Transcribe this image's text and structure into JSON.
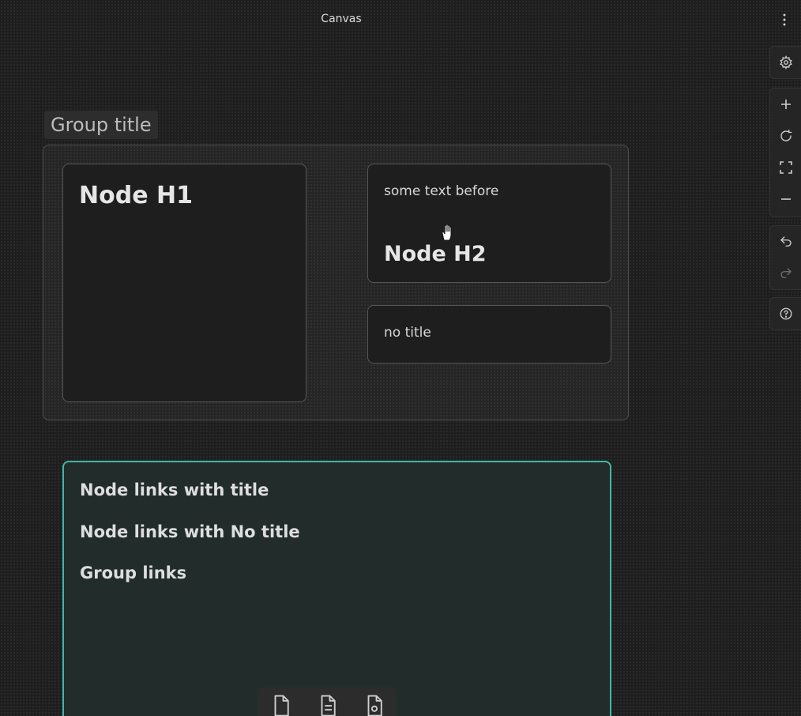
{
  "window": {
    "title": "Canvas"
  },
  "group": {
    "title": "Group title"
  },
  "nodes": {
    "h1_title": "Node H1",
    "h2_text_before": "some text before",
    "h2_title": "Node H2",
    "no_title_text": "no title"
  },
  "links_node": {
    "links": [
      "Node links with title",
      "Node links with No title",
      "Group links"
    ]
  },
  "toolbar": {
    "right_icons": [
      "settings-icon",
      "zoom-in-icon",
      "reset-zoom-icon",
      "fit-view-icon",
      "zoom-out-icon",
      "undo-icon",
      "redo-icon",
      "help-icon"
    ],
    "bottom_icons": [
      "file-icon",
      "note-icon",
      "media-icon"
    ]
  },
  "colors": {
    "background": "#1e1e1e",
    "accent_border": "#3fb8a6",
    "node_border": "#565656"
  }
}
